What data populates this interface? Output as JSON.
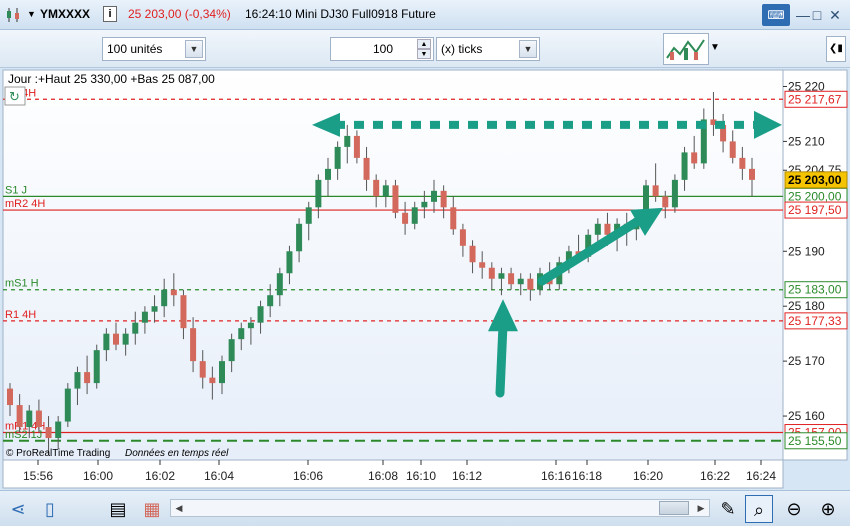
{
  "titlebar": {
    "symbol": "YMXXXX",
    "info_icon": "info-icon",
    "price_change": "25 203,00 (-0,34%)",
    "time_name": "16:24:10 Mini DJ30 Full0918 Future",
    "window_buttons": [
      "keyboard-icon",
      "minimize-icon",
      "maximize-icon",
      "close-icon"
    ]
  },
  "toolbar": {
    "units_value": "100 unités",
    "quantity_value": "100",
    "ticks_value": "(x) ticks"
  },
  "chart": {
    "header": "Jour :+Haut 25 330,00 +Bas 25 087,00",
    "footer_brand": "© ProRealTime Trading",
    "footer_status": "Données en temps réel",
    "colors": {
      "up": "#2e8b57",
      "down": "#d2695c",
      "wick": "#555555",
      "arrow": "#1a9e88",
      "last_price_bg": "#f5c400"
    }
  },
  "chart_data": {
    "type": "candlestick",
    "ylim": [
      25152,
      25223
    ],
    "y_ticks": [
      {
        "value": 25220,
        "label": "25 220"
      },
      {
        "value": 25210,
        "label": "25 210"
      },
      {
        "value": 25204.75,
        "label": "25 204,75"
      },
      {
        "value": 25190,
        "label": "25 190"
      },
      {
        "value": 25180,
        "label": "25 180"
      },
      {
        "value": 25170,
        "label": "25 170"
      },
      {
        "value": 25160,
        "label": "25 160"
      }
    ],
    "x_ticks": [
      "15:56",
      "16:00",
      "16:02",
      "16:04",
      "16:06",
      "16:08",
      "16:10",
      "16:12",
      "16:16",
      "16:18",
      "16:20",
      "16:22",
      "16:24"
    ],
    "levels": [
      {
        "name": "R2 4H",
        "value": 25217.67,
        "label": "25 217,67",
        "color": "#e02020",
        "style": "dashed",
        "name_color": "#e02020"
      },
      {
        "name": "S1 J",
        "value": 25200.0,
        "label": "25 200,00",
        "color": "#2a8a2a",
        "style": "solid",
        "name_color": "#2a8a2a"
      },
      {
        "name": "mR2 4H",
        "value": 25197.5,
        "label": "25 197,50",
        "color": "#e02020",
        "style": "solid",
        "name_color": "#e02020"
      },
      {
        "name": "mS1 H",
        "value": 25183.0,
        "label": "25 183,00",
        "color": "#2a8a2a",
        "style": "dashed",
        "name_color": "#2a8a2a"
      },
      {
        "name": "R1 4H",
        "value": 25177.33,
        "label": "25 177,33",
        "color": "#e02020",
        "style": "dashed",
        "name_color": "#e02020"
      },
      {
        "name": "mR1 4H",
        "value": 25157.0,
        "label": "25 157,00",
        "color": "#e02020",
        "style": "solid",
        "name_color": "#e02020"
      },
      {
        "name": "mS2 1J",
        "value": 25155.5,
        "label": "25 155,50",
        "color": "#2a8a2a",
        "style": "longdash",
        "name_color": "#2a8a2a"
      }
    ],
    "last_price": {
      "value": 25203.0,
      "label": "25 203,00"
    },
    "candles": [
      [
        25165,
        25166,
        25160,
        25162
      ],
      [
        25162,
        25164,
        25157,
        25158
      ],
      [
        25158,
        25162,
        25156,
        25161
      ],
      [
        25161,
        25163,
        25157,
        25158
      ],
      [
        25158,
        25160,
        25153,
        25156
      ],
      [
        25156,
        25160,
        25154,
        25159
      ],
      [
        25159,
        25166,
        25158,
        25165
      ],
      [
        25165,
        25169,
        25162,
        25168
      ],
      [
        25168,
        25171,
        25164,
        25166
      ],
      [
        25166,
        25173,
        25165,
        25172
      ],
      [
        25172,
        25176,
        25170,
        25175
      ],
      [
        25175,
        25177,
        25172,
        25173
      ],
      [
        25173,
        25176,
        25171,
        25175
      ],
      [
        25175,
        25179,
        25173,
        25177
      ],
      [
        25177,
        25180,
        25175,
        25179
      ],
      [
        25179,
        25182,
        25177,
        25180
      ],
      [
        25180,
        25185,
        25178,
        25183
      ],
      [
        25183,
        25186,
        25180,
        25182
      ],
      [
        25182,
        25183,
        25174,
        25176
      ],
      [
        25176,
        25178,
        25168,
        25170
      ],
      [
        25170,
        25172,
        25165,
        25167
      ],
      [
        25167,
        25169,
        25163,
        25166
      ],
      [
        25166,
        25171,
        25164,
        25170
      ],
      [
        25170,
        25175,
        25168,
        25174
      ],
      [
        25174,
        25177,
        25172,
        25176
      ],
      [
        25176,
        25178,
        25173,
        25177
      ],
      [
        25177,
        25181,
        25175,
        25180
      ],
      [
        25180,
        25184,
        25178,
        25182
      ],
      [
        25182,
        25187,
        25180,
        25186
      ],
      [
        25186,
        25191,
        25184,
        25190
      ],
      [
        25190,
        25196,
        25188,
        25195
      ],
      [
        25195,
        25199,
        25192,
        25198
      ],
      [
        25198,
        25204,
        25196,
        25203
      ],
      [
        25203,
        25207,
        25200,
        25205
      ],
      [
        25205,
        25210,
        25203,
        25209
      ],
      [
        25209,
        25213,
        25206,
        25211
      ],
      [
        25211,
        25212,
        25206,
        25207
      ],
      [
        25207,
        25209,
        25201,
        25203
      ],
      [
        25203,
        25204,
        25198,
        25200
      ],
      [
        25200,
        25203,
        25198,
        25202
      ],
      [
        25202,
        25203,
        25196,
        25197
      ],
      [
        25197,
        25199,
        25193,
        25195
      ],
      [
        25195,
        25199,
        25194,
        25198
      ],
      [
        25198,
        25201,
        25196,
        25199
      ],
      [
        25199,
        25203,
        25197,
        25201
      ],
      [
        25201,
        25202,
        25196,
        25198
      ],
      [
        25198,
        25200,
        25193,
        25194
      ],
      [
        25194,
        25195,
        25189,
        25191
      ],
      [
        25191,
        25192,
        25186,
        25188
      ],
      [
        25188,
        25190,
        25185,
        25187
      ],
      [
        25187,
        25188,
        25183,
        25185
      ],
      [
        25185,
        25187,
        25182,
        25186
      ],
      [
        25186,
        25187,
        25183,
        25184
      ],
      [
        25184,
        25186,
        25182,
        25185
      ],
      [
        25185,
        25186,
        25181,
        25183
      ],
      [
        25183,
        25187,
        25182,
        25186
      ],
      [
        25186,
        25188,
        25183,
        25184
      ],
      [
        25184,
        25189,
        25183,
        25188
      ],
      [
        25188,
        25191,
        25186,
        25190
      ],
      [
        25190,
        25193,
        25188,
        25189
      ],
      [
        25189,
        25194,
        25188,
        25193
      ],
      [
        25193,
        25196,
        25191,
        25195
      ],
      [
        25195,
        25197,
        25191,
        25193
      ],
      [
        25193,
        25196,
        25190,
        25195
      ],
      [
        25195,
        25197,
        25191,
        25194
      ],
      [
        25194,
        25197,
        25192,
        25196
      ],
      [
        25196,
        25203,
        25195,
        25202
      ],
      [
        25202,
        25206,
        25199,
        25200
      ],
      [
        25200,
        25201,
        25196,
        25198
      ],
      [
        25198,
        25204,
        25197,
        25203
      ],
      [
        25203,
        25209,
        25201,
        25208
      ],
      [
        25208,
        25211,
        25205,
        25206
      ],
      [
        25206,
        25216,
        25205,
        25214
      ],
      [
        25214,
        25219,
        25211,
        25213
      ],
      [
        25213,
        25215,
        25208,
        25210
      ],
      [
        25210,
        25212,
        25206,
        25207
      ],
      [
        25207,
        25209,
        25203,
        25205
      ],
      [
        25205,
        25207,
        25200,
        25203
      ]
    ],
    "arrows": [
      {
        "kind": "dashed-horizontal",
        "from_value": 25213,
        "to_value": 25213
      },
      {
        "kind": "solid-up-vertical",
        "value_tip": 25182
      },
      {
        "kind": "solid-diagonal",
        "value_tip": 25199
      }
    ]
  },
  "bottombar": {
    "icons": [
      "share-icon",
      "phone-icon",
      "chart-list-icon",
      "indicator-icon",
      "cursor-icon",
      "zoom-fit-icon",
      "zoom-out-icon",
      "zoom-in-icon"
    ]
  }
}
